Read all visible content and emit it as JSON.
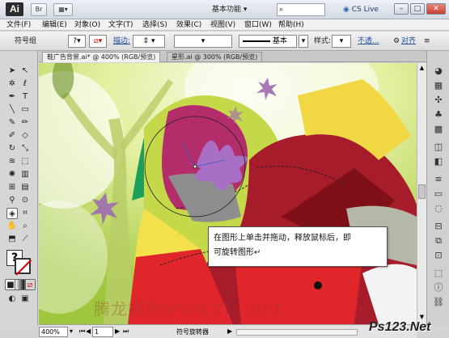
{
  "title_bar": {
    "app_logo": "Ai",
    "workspace_label": "基本功能",
    "search_placeholder": "",
    "cs_live": "CS Live",
    "window_buttons": [
      "–",
      "□",
      "✕"
    ]
  },
  "menu": {
    "items": [
      "文件(F)",
      "编辑(E)",
      "对象(O)",
      "文字(T)",
      "选择(S)",
      "效果(C)",
      "视图(V)",
      "窗口(W)",
      "帮助(H)"
    ]
  },
  "control_bar": {
    "group_label": "符号组",
    "stroke_label": "描边:",
    "basic_label": "基本",
    "style_label": "样式:",
    "opacity_label": "不透...",
    "align_label": "对齐"
  },
  "tabs": [
    {
      "label": "鞋广告背景.ai* @ 400% (RGB/预览)",
      "active": true
    },
    {
      "label": "星形.ai @ 300% (RGB/预览)",
      "active": false
    }
  ],
  "callout": {
    "line1": "在图形上单击并拖动，释放鼠标后，即",
    "line2": "可旋转图形↵"
  },
  "status_bar": {
    "zoom": "400%",
    "page": "1",
    "tool_name": "符号旋转器"
  },
  "watermark": "腾龙视觉WWW.TL...NET",
  "site_logo": "Ps123.Net",
  "icons": {
    "toolbox": [
      "selection-icon",
      "direct-selection-icon",
      "magic-wand-icon",
      "lasso-icon",
      "pen-icon",
      "type-icon",
      "line-icon",
      "rectangle-icon",
      "paintbrush-icon",
      "pencil-icon",
      "blob-brush-icon",
      "eraser-icon",
      "rotate-icon",
      "scale-icon",
      "warp-icon",
      "free-transform-icon",
      "symbol-sprayer-icon",
      "column-graph-icon",
      "mesh-icon",
      "gradient-icon",
      "eyedropper-icon",
      "blend-icon",
      "live-paint-icon",
      "slice-icon",
      "hand-icon",
      "zoom-icon"
    ],
    "dock": [
      "color-icon",
      "swatches-icon",
      "brushes-icon",
      "symbols-icon",
      "graphic-styles-icon",
      "appearance-icon",
      "layers-icon",
      "stroke-icon",
      "gradient-panel-icon",
      "transparency-icon",
      "align-icon",
      "pathfinder-icon",
      "transform-icon",
      "artboards-icon",
      "info-icon",
      "links-icon"
    ]
  }
}
